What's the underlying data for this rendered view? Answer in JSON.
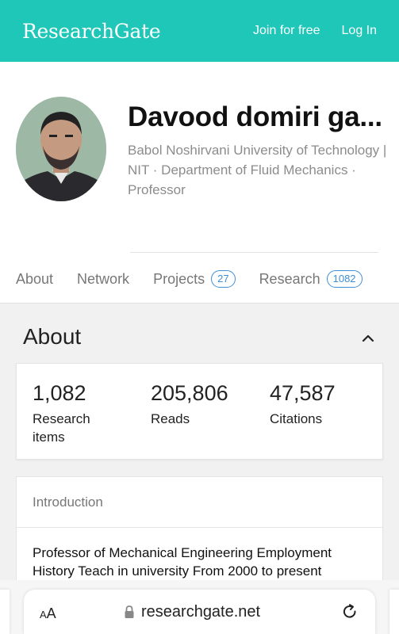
{
  "header": {
    "logo": "ResearchGate",
    "join_label": "Join for free",
    "login_label": "Log In",
    "brand_color": "#1ec7b7"
  },
  "profile": {
    "name": "Davood domiri ga...",
    "affiliation": "Babol Noshirvani University of Technology | NIT · Department of Fluid Mechanics · Professor"
  },
  "tabs": [
    {
      "label": "About"
    },
    {
      "label": "Network"
    },
    {
      "label": "Projects",
      "count": "27"
    },
    {
      "label": "Research",
      "count": "1082"
    }
  ],
  "about": {
    "title": "About",
    "stats": [
      {
        "value": "1,082",
        "label": "Research items"
      },
      {
        "value": "205,806",
        "label": "Reads"
      },
      {
        "value": "47,587",
        "label": "Citations"
      }
    ],
    "intro_heading": "Introduction",
    "intro_text": "Professor of Mechanical Engineering Employment History Teach in university From 2000 to present"
  },
  "browser": {
    "text_size_label": "AA",
    "url": "researchgate.net",
    "icons": [
      "lock-icon",
      "reload-icon",
      "chevron-up-icon"
    ]
  }
}
